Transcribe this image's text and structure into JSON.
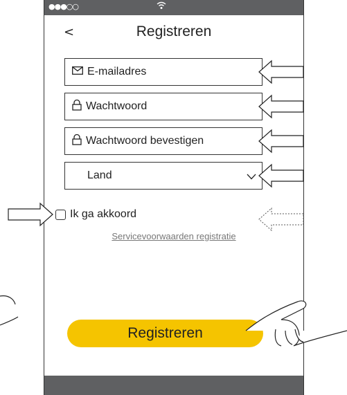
{
  "status_bar": {
    "signal": "●●●○○",
    "wifi": "ᯤ"
  },
  "header": {
    "back": "<",
    "title": "Registreren"
  },
  "form": {
    "email_label": "E-mailadres",
    "password_label": "Wachtwoord",
    "confirm_label": "Wachtwoord bevestigen",
    "country_label": "Land"
  },
  "agree": {
    "label": "Ik ga akkoord",
    "terms_link": "Servicevoorwaarden registratie"
  },
  "register_button": "Registreren",
  "icons": [
    "envelope-icon",
    "lock-icon",
    "lock-icon",
    "chevron-down-icon",
    "arrow-icon",
    "hand-icon"
  ],
  "colors": {
    "accent": "#f5c400",
    "bar": "#5f6062"
  }
}
